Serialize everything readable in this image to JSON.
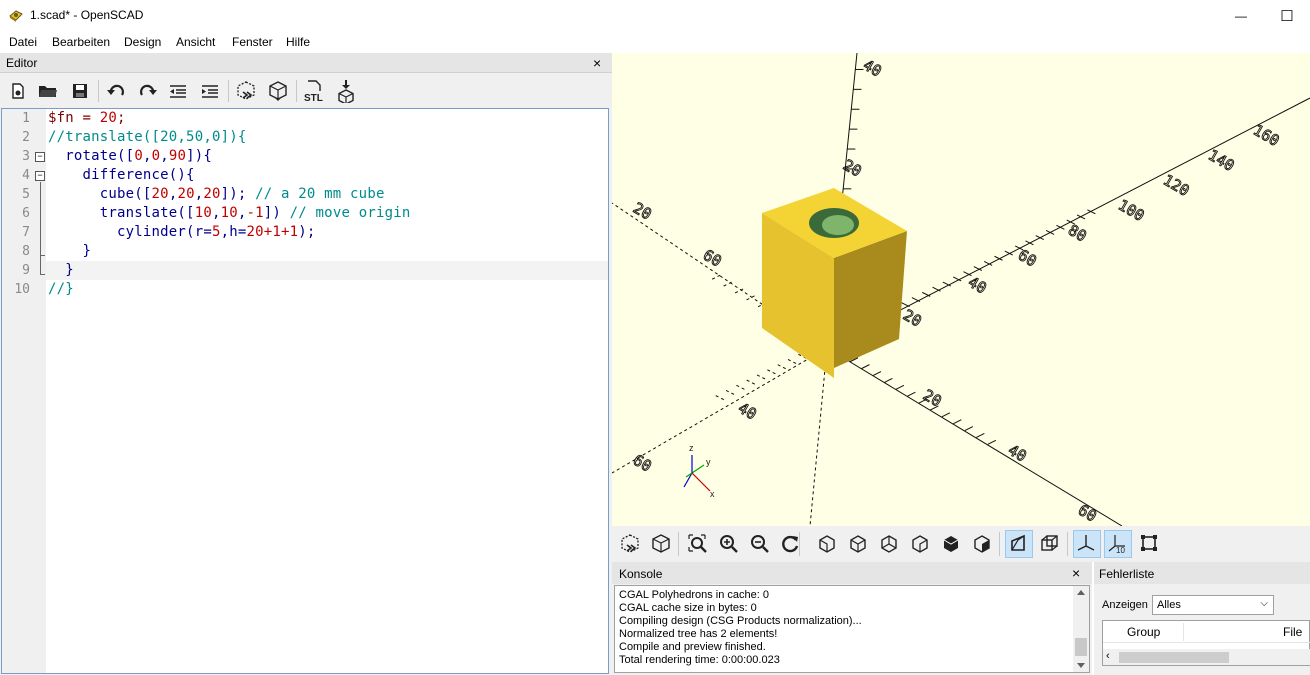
{
  "window": {
    "title": "1.scad* - OpenSCAD",
    "minimize": "—",
    "maximize": "☐"
  },
  "menu": [
    "Datei",
    "Bearbeiten",
    "Design",
    "Ansicht",
    "Fenster",
    "Hilfe"
  ],
  "editor": {
    "title": "Editor",
    "close": "×",
    "toolbar": [
      "new-icon",
      "open-icon",
      "save-icon",
      "undo-icon",
      "redo-icon",
      "unindent-icon",
      "indent-icon",
      "preview-icon",
      "render-icon",
      "export-stl-icon",
      "send-to-print-icon"
    ],
    "line_numbers": [
      "1",
      "2",
      "3",
      "4",
      "5",
      "6",
      "7",
      "8",
      "9",
      "10"
    ],
    "lines": [
      [
        {
          "t": "$fn = ",
          "c": "#800000"
        },
        {
          "t": "20",
          "c": "#c00000"
        },
        {
          "t": ";",
          "c": "#800000"
        }
      ],
      [
        {
          "t": "//translate([20,50,0]){",
          "c": "#008b8b"
        }
      ],
      [
        {
          "t": "  rotate(",
          "c": "#00008b"
        },
        {
          "t": "[",
          "c": "#00008b"
        },
        {
          "t": "0",
          "c": "#c00000"
        },
        {
          "t": ",",
          "c": "#00008b"
        },
        {
          "t": "0",
          "c": "#c00000"
        },
        {
          "t": ",",
          "c": "#00008b"
        },
        {
          "t": "90",
          "c": "#c00000"
        },
        {
          "t": "]){",
          "c": "#00008b"
        }
      ],
      [
        {
          "t": "    difference(){",
          "c": "#00008b"
        }
      ],
      [
        {
          "t": "      cube([",
          "c": "#00008b"
        },
        {
          "t": "20",
          "c": "#c00000"
        },
        {
          "t": ",",
          "c": "#00008b"
        },
        {
          "t": "20",
          "c": "#c00000"
        },
        {
          "t": ",",
          "c": "#00008b"
        },
        {
          "t": "20",
          "c": "#c00000"
        },
        {
          "t": "]); ",
          "c": "#00008b"
        },
        {
          "t": "// a 20 mm cube",
          "c": "#008b8b"
        }
      ],
      [
        {
          "t": "      translate([",
          "c": "#00008b"
        },
        {
          "t": "10",
          "c": "#c00000"
        },
        {
          "t": ",",
          "c": "#00008b"
        },
        {
          "t": "10",
          "c": "#c00000"
        },
        {
          "t": ",",
          "c": "#00008b"
        },
        {
          "t": "-1",
          "c": "#c00000"
        },
        {
          "t": "]) ",
          "c": "#00008b"
        },
        {
          "t": "// move origin",
          "c": "#008b8b"
        }
      ],
      [
        {
          "t": "        cylinder(r=",
          "c": "#00008b"
        },
        {
          "t": "5",
          "c": "#c00000"
        },
        {
          "t": ",h=",
          "c": "#00008b"
        },
        {
          "t": "20+1+1",
          "c": "#c00000"
        },
        {
          "t": ");",
          "c": "#00008b"
        }
      ],
      [
        {
          "t": "    }",
          "c": "#00008b"
        }
      ],
      [
        {
          "t": "  }",
          "c": "#00008b"
        }
      ],
      [
        {
          "t": "//}",
          "c": "#008b8b"
        }
      ]
    ]
  },
  "viewport": {
    "axis_labels": [
      "60",
      "40",
      "20",
      "20",
      "40",
      "60",
      "80",
      "100",
      "120",
      "140",
      "160",
      "20",
      "40",
      "60",
      "20",
      "40",
      "60"
    ],
    "gizmo": {
      "z": "z",
      "x": "x",
      "y": "y"
    },
    "model_color": "#f0d040"
  },
  "view_toolbar": [
    "preview-icon",
    "render-icon",
    "view-all-icon",
    "zoom-in-icon",
    "zoom-out-icon",
    "reset-view-icon",
    "view-right-icon",
    "view-top-icon",
    "view-bottom-icon",
    "view-left-icon",
    "view-front-icon",
    "view-back-icon",
    "perspective-icon",
    "orthogonal-icon",
    "show-axes-icon",
    "show-scale-icon",
    "show-edges-icon"
  ],
  "console": {
    "title": "Konsole",
    "close": "×",
    "lines": [
      "CGAL Polyhedrons in cache: 0",
      "CGAL cache size in bytes: 0",
      "Compiling design (CSG Products normalization)...",
      "Normalized tree has 2 elements!",
      "Compile and preview finished.",
      "Total rendering time: 0:00:00.023"
    ]
  },
  "errors": {
    "title": "Fehlerliste",
    "filter_label": "Anzeigen",
    "filter_value": "Alles",
    "columns": [
      "Group",
      "File"
    ]
  }
}
